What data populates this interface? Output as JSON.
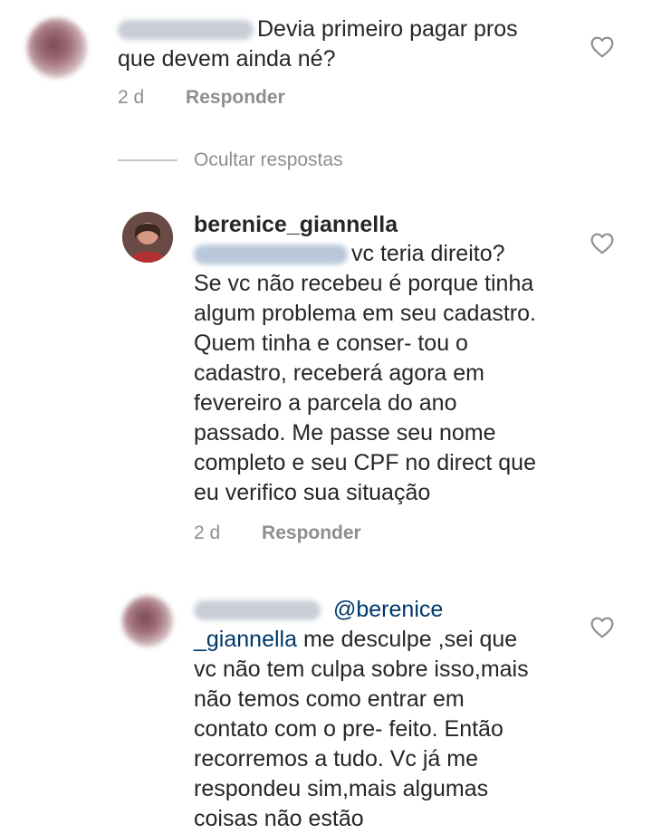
{
  "comments": [
    {
      "text": "Devia primeiro pagar pros que devem ainda né?",
      "time": "2 d",
      "reply_label": "Responder"
    }
  ],
  "thread": {
    "hide_label": "Ocultar respostas"
  },
  "replies": [
    {
      "username": "berenice_giannella",
      "text_line1": "vc teria direito?",
      "text_body": "Se vc não recebeu é porque tinha algum problema em seu cadastro. Quem tinha e conser- tou o cadastro, receberá agora em fevereiro a parcela do ano passado. Me passe seu nome completo e seu CPF no direct que eu verifico sua situação",
      "time": "2 d",
      "reply_label": "Responder"
    },
    {
      "mention_part1": "@berenice",
      "mention_part2": "_giannella",
      "text_rest": " me desculpe ,sei que vc não tem culpa sobre isso,mais não temos como entrar em contato com o pre- feito. Então recorremos a tudo. Vc já me respondeu sim,mais algumas coisas não estão"
    }
  ],
  "icons": {
    "like": "heart-outline-icon"
  }
}
